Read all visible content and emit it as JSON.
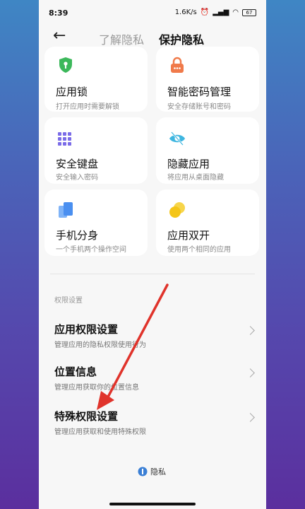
{
  "status": {
    "time": "8:39",
    "speed": "1.6K/s",
    "battery": "67"
  },
  "header": {
    "tab_inactive": "了解隐私",
    "tab_active": "保护隐私"
  },
  "cards": [
    {
      "title": "应用锁",
      "sub": "打开应用时需要解锁",
      "icon": "shield-lock-icon",
      "color": "#3cb85b"
    },
    {
      "title": "智能密码管理",
      "sub": "安全存储账号和密码",
      "icon": "padlock-icon",
      "color": "#f07a4a"
    },
    {
      "title": "安全键盘",
      "sub": "安全输入密码",
      "icon": "keyboard-icon",
      "color": "#7b6ce8"
    },
    {
      "title": "隐藏应用",
      "sub": "将应用从桌面隐藏",
      "icon": "eye-hidden-icon",
      "color": "#3fb6e0"
    },
    {
      "title": "手机分身",
      "sub": "一个手机两个操作空间",
      "icon": "dual-phone-icon",
      "color": "#4a8ff0"
    },
    {
      "title": "应用双开",
      "sub": "使用两个相同的应用",
      "icon": "dual-app-icon",
      "color": "#f4c518"
    }
  ],
  "section_label": "权限设置",
  "rows": [
    {
      "title": "应用权限设置",
      "sub": "管理应用的隐私权限使用行为"
    },
    {
      "title": "位置信息",
      "sub": "管理应用获取你的位置信息"
    },
    {
      "title": "特殊权限设置",
      "sub": "管理应用获取和使用特殊权限"
    }
  ],
  "footer": {
    "label": "隐私"
  }
}
